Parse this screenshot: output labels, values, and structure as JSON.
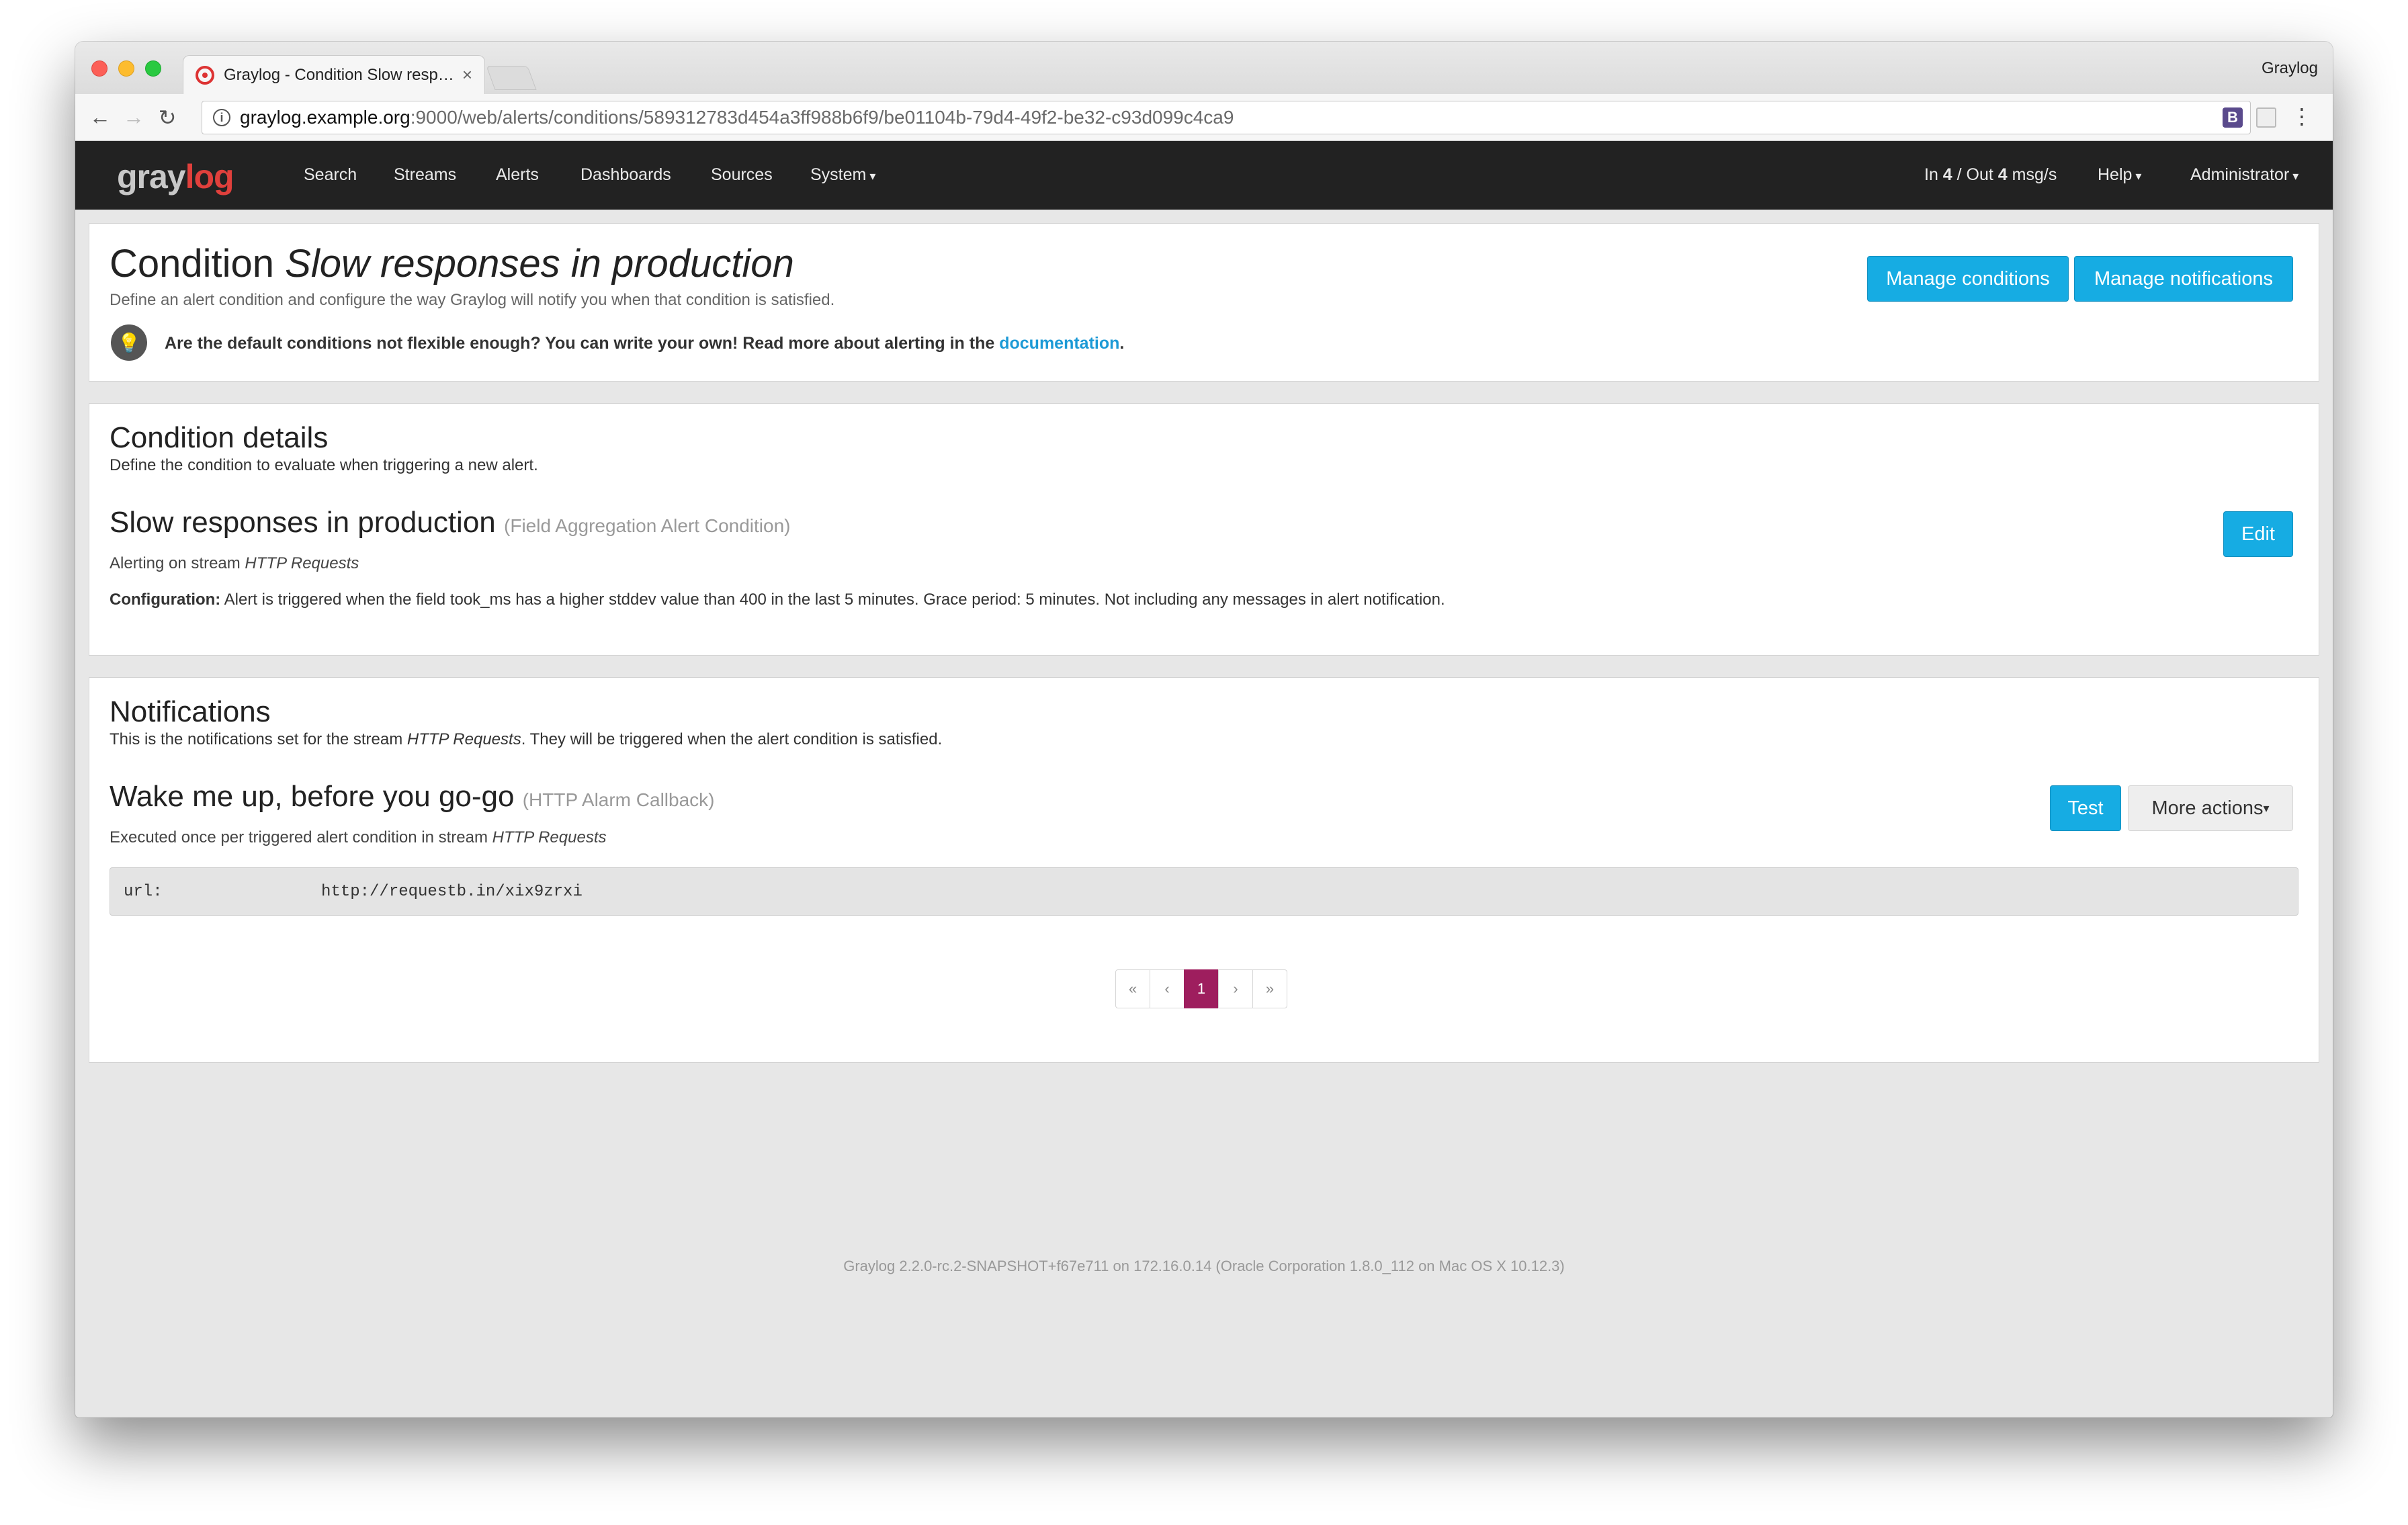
{
  "browser": {
    "tab_title": "Graylog - Condition Slow resp…",
    "tab_close": "×",
    "window_owner": "Graylog",
    "url_host": "graylog.example.org",
    "url_rest": ":9000/web/alerts/conditions/589312783d454a3ff988b6f9/be01104b-79d4-49f2-be32-c93d099c4ca9",
    "ext_b": "B"
  },
  "nav": {
    "logo_gray": "gray",
    "logo_red": "log",
    "items": [
      "Search",
      "Streams",
      "Alerts",
      "Dashboards",
      "Sources",
      "System"
    ],
    "throughput_in_label": "In ",
    "throughput_in": "4",
    "throughput_sep": " / Out ",
    "throughput_out": "4",
    "throughput_unit": " msg/s",
    "help": "Help",
    "user": "Administrator"
  },
  "header": {
    "title_prefix": "Condition ",
    "title_name": "Slow responses in production",
    "description": "Define an alert condition and configure the way Graylog will notify you when that condition is satisfied.",
    "tip_text": "Are the default conditions not flexible enough? You can write your own! Read more about alerting in the ",
    "tip_link": "documentation",
    "tip_end": ".",
    "manage_conditions": "Manage conditions",
    "manage_notifications": "Manage notifications"
  },
  "condition": {
    "section_title": "Condition details",
    "section_desc": "Define the condition to evaluate when triggering a new alert.",
    "name": "Slow responses in production",
    "type": "(Field Aggregation Alert Condition)",
    "stream_prefix": "Alerting on stream ",
    "stream": "HTTP Requests",
    "config_label": "Configuration:",
    "config_text": " Alert is triggered when the field took_ms has a higher stddev value than 400 in the last 5 minutes. Grace period: 5 minutes. Not including any messages in alert notification.",
    "edit": "Edit"
  },
  "notifications": {
    "section_title": "Notifications",
    "desc_prefix": "This is the notifications set for the stream ",
    "desc_stream": "HTTP Requests",
    "desc_suffix": ". They will be triggered when the alert condition is satisfied.",
    "name": "Wake me up, before you go-go",
    "type": "(HTTP Alarm Callback)",
    "exec_prefix": "Executed once per triggered alert condition in stream ",
    "exec_stream": "HTTP Requests",
    "test": "Test",
    "more_actions": "More actions",
    "config_key": "url:",
    "config_value": "http://requestb.in/xix9zrxi"
  },
  "pagination": {
    "first": "«",
    "prev": "‹",
    "current": "1",
    "next": "›",
    "last": "»"
  },
  "footer": "Graylog 2.2.0-rc.2-SNAPSHOT+f67e711 on 172.16.0.14 (Oracle Corporation 1.8.0_112 on Mac OS X 10.12.3)"
}
